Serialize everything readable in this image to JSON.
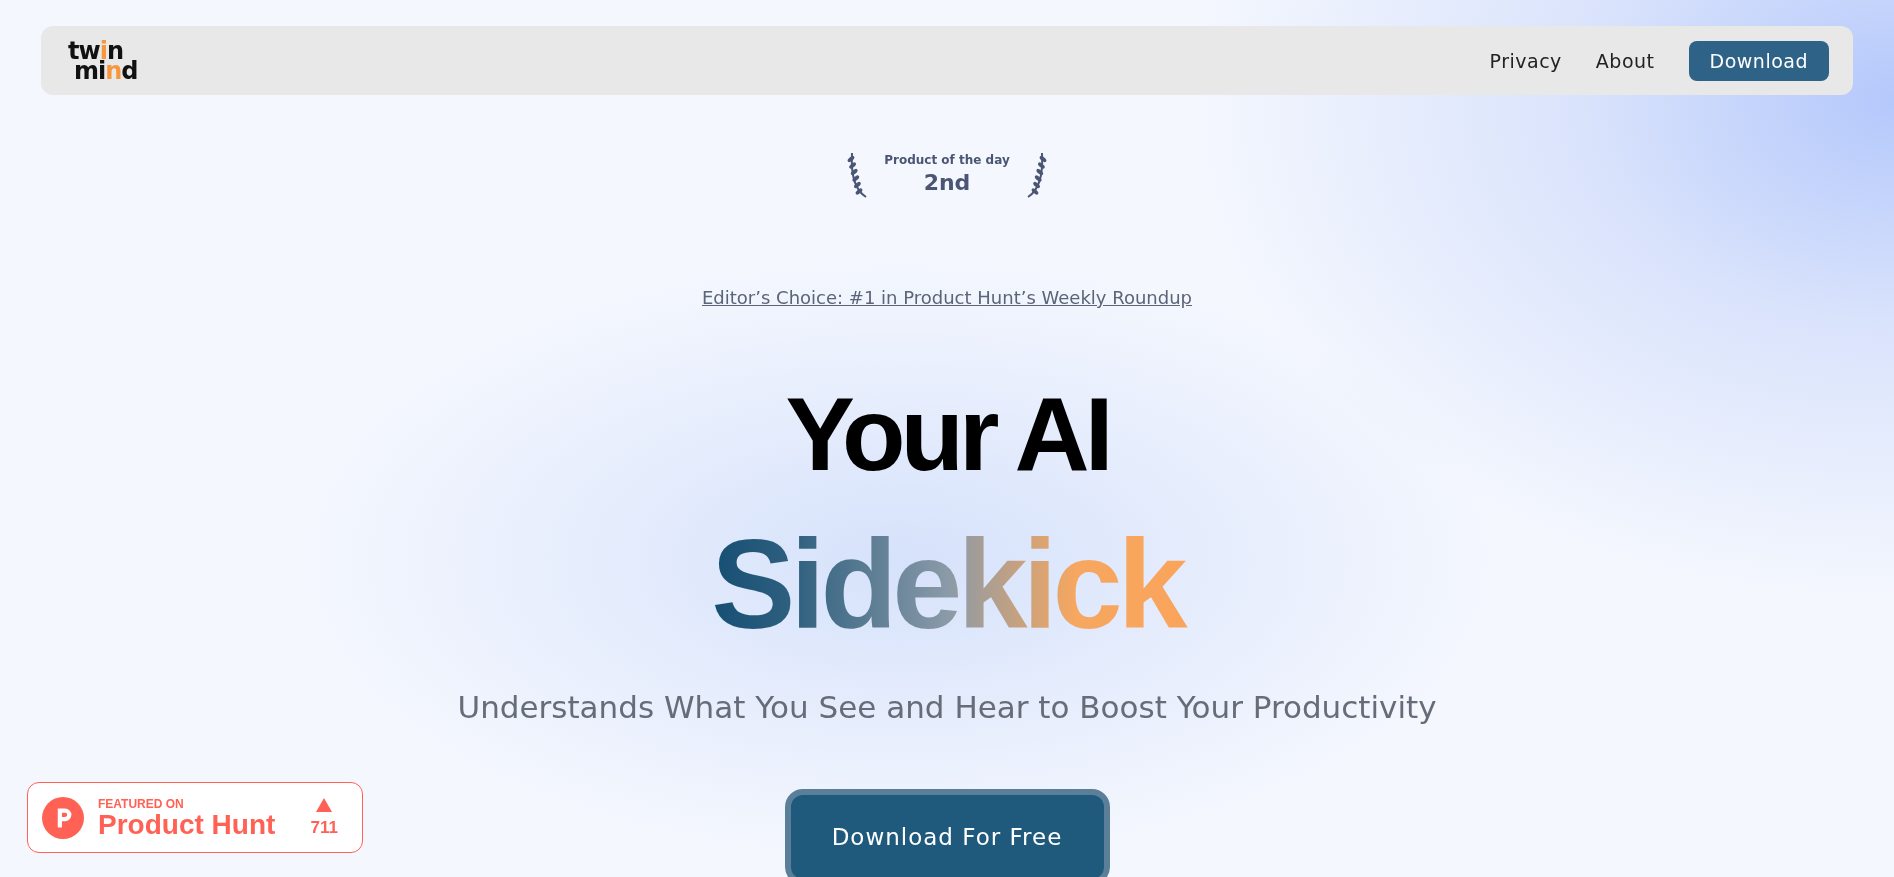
{
  "nav": {
    "logo": [
      "twin",
      "mind"
    ],
    "links": [
      "Privacy",
      "About"
    ],
    "button": "Download"
  },
  "award": {
    "title": "Product of the day",
    "rank": "2nd"
  },
  "editor_link": "Editor’s Choice: #1 in Product Hunt’s Weekly Roundup",
  "headline": {
    "line_1": "Your AI",
    "line_2": "Sidekick"
  },
  "subtitle": "Understands What You See and Hear to Boost Your Productivity",
  "cta": "Download For Free",
  "product_hunt": {
    "caption": "FEATURED ON",
    "name": "Product Hunt",
    "votes": "711"
  }
}
